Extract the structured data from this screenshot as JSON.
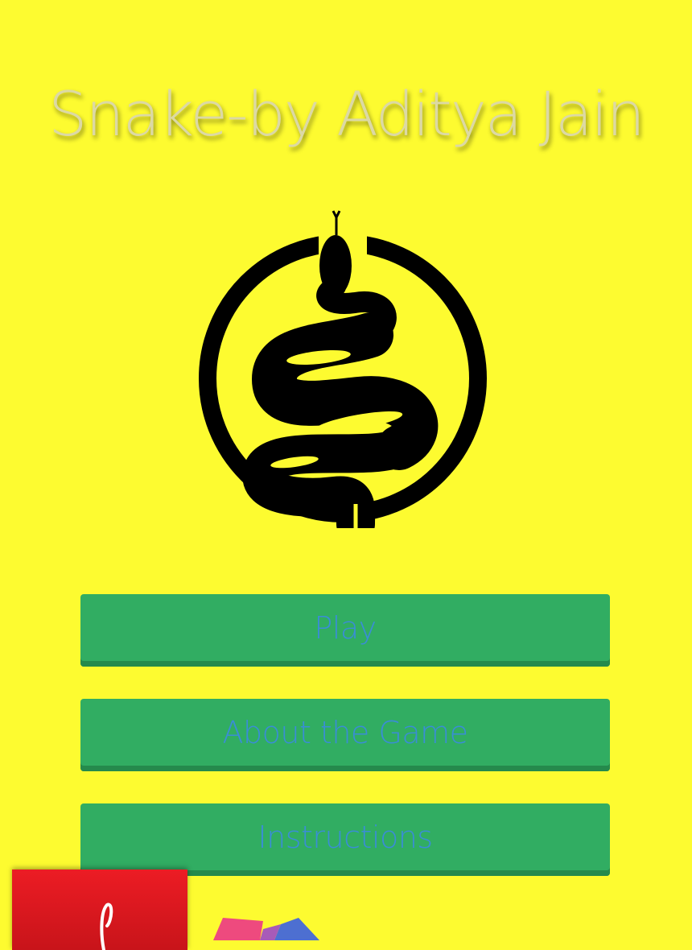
{
  "title": "Snake-by Aditya Jain",
  "logo_icon": "snake-circle-icon",
  "menu": {
    "play_label": "Play",
    "about_label": "About the Game",
    "instructions_label": "Instructions"
  },
  "colors": {
    "background": "#fdfb30",
    "button": "#31ad62",
    "button_text": "#3a8dd6",
    "title_text": "#dcd9a4"
  },
  "overlay": {
    "red_badge_icon": "app-logo-icon",
    "shapes_icon": "colorful-shapes-icon"
  }
}
